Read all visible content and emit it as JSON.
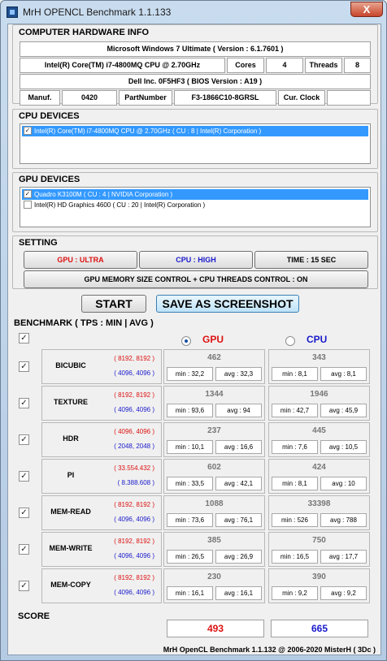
{
  "window": {
    "title": "MrH OPENCL Benchmark 1.1.133",
    "close_label": "X"
  },
  "hardware": {
    "title": "COMPUTER HARDWARE INFO",
    "os": "Microsoft Windows 7 Ultimate  ( Version : 6.1.7601 )",
    "cpu": "Intel(R) Core(TM) i7-4800MQ CPU @ 2.70GHz",
    "cores_label": "Cores",
    "cores_value": "4",
    "threads_label": "Threads",
    "threads_value": "8",
    "board": "Dell Inc. 0F5HF3 ( BIOS Version : A19 )",
    "manuf_label": "Manuf.",
    "manuf_value": "0420",
    "part_label": "PartNumber",
    "part_value": "F3-1866C10-8GRSL",
    "clock_label": "Cur. Clock",
    "clock_value": ""
  },
  "cpu_devices": {
    "title": "CPU DEVICES",
    "items": [
      {
        "label": "Intel(R) Core(TM) i7-4800MQ CPU @ 2.70GHz ( CU : 8 | Intel(R) Corporation )",
        "checked": true
      }
    ]
  },
  "gpu_devices": {
    "title": "GPU DEVICES",
    "items": [
      {
        "label": "Quadro K3100M ( CU : 4 | NVIDIA Corporation )",
        "checked": true
      },
      {
        "label": "Intel(R) HD Graphics 4600 ( CU : 20 | Intel(R) Corporation )",
        "checked": false
      }
    ]
  },
  "setting": {
    "title": "SETTING",
    "gpu_level": "GPU : ULTRA",
    "cpu_level": "CPU : HIGH",
    "time": "TIME : 15 SEC",
    "control": "GPU MEMORY SIZE CONTROL + CPU THREADS CONTROL : ON",
    "colors": {
      "gpu": "#dd1111",
      "cpu": "#1a1acc"
    }
  },
  "actions": {
    "start": "START",
    "save": "SAVE AS SCREENSHOT"
  },
  "benchmark": {
    "title": "BENCHMARK ( TPS : MIN | AVG )",
    "gpu_header": "GPU",
    "cpu_header": "CPU",
    "rows": [
      {
        "name": "BICUBIC",
        "gpu_size": "( 8192, 8192 )",
        "cpu_size": "( 4096, 4096 )",
        "gpu_val": "462",
        "gpu_min": "min : 32,2",
        "gpu_avg": "avg : 32,3",
        "cpu_val": "343",
        "cpu_min": "min : 8,1",
        "cpu_avg": "avg : 8,1"
      },
      {
        "name": "TEXTURE",
        "gpu_size": "( 8192, 8192 )",
        "cpu_size": "( 4096, 4096 )",
        "gpu_val": "1344",
        "gpu_min": "min : 93,6",
        "gpu_avg": "avg : 94",
        "cpu_val": "1946",
        "cpu_min": "min : 42,7",
        "cpu_avg": "avg : 45,9"
      },
      {
        "name": "HDR",
        "gpu_size": "( 4096, 4096 )",
        "cpu_size": "( 2048, 2048 )",
        "gpu_val": "237",
        "gpu_min": "min : 10,1",
        "gpu_avg": "avg : 16,6",
        "cpu_val": "445",
        "cpu_min": "min : 7,6",
        "cpu_avg": "avg : 10,5"
      },
      {
        "name": "PI",
        "gpu_size": "( 33.554.432 )",
        "cpu_size": "( 8.388.608 )",
        "gpu_val": "602",
        "gpu_min": "min : 33,5",
        "gpu_avg": "avg : 42,1",
        "cpu_val": "424",
        "cpu_min": "min : 8,1",
        "cpu_avg": "avg : 10"
      },
      {
        "name": "MEM-READ",
        "gpu_size": "( 8192, 8192 )",
        "cpu_size": "( 4096, 4096 )",
        "gpu_val": "1088",
        "gpu_min": "min : 73,6",
        "gpu_avg": "avg : 76,1",
        "cpu_val": "33398",
        "cpu_min": "min : 526",
        "cpu_avg": "avg : 788"
      },
      {
        "name": "MEM-WRITE",
        "gpu_size": "( 8192, 8192 )",
        "cpu_size": "( 4096, 4096 )",
        "gpu_val": "385",
        "gpu_min": "min : 26,5",
        "gpu_avg": "avg : 26,9",
        "cpu_val": "750",
        "cpu_min": "min : 16,5",
        "cpu_avg": "avg : 17,7"
      },
      {
        "name": "MEM-COPY",
        "gpu_size": "( 8192, 8192 )",
        "cpu_size": "( 4096, 4096 )",
        "gpu_val": "230",
        "gpu_min": "min : 16,1",
        "gpu_avg": "avg : 16,1",
        "cpu_val": "390",
        "cpu_min": "min : 9,2",
        "cpu_avg": "avg : 9,2"
      }
    ]
  },
  "score": {
    "title": "SCORE",
    "gpu": "493",
    "cpu": "665"
  },
  "footer": "MrH OpenCL Benchmark 1.1.132  @  2006-2020 MisterH ( 3Dc )"
}
